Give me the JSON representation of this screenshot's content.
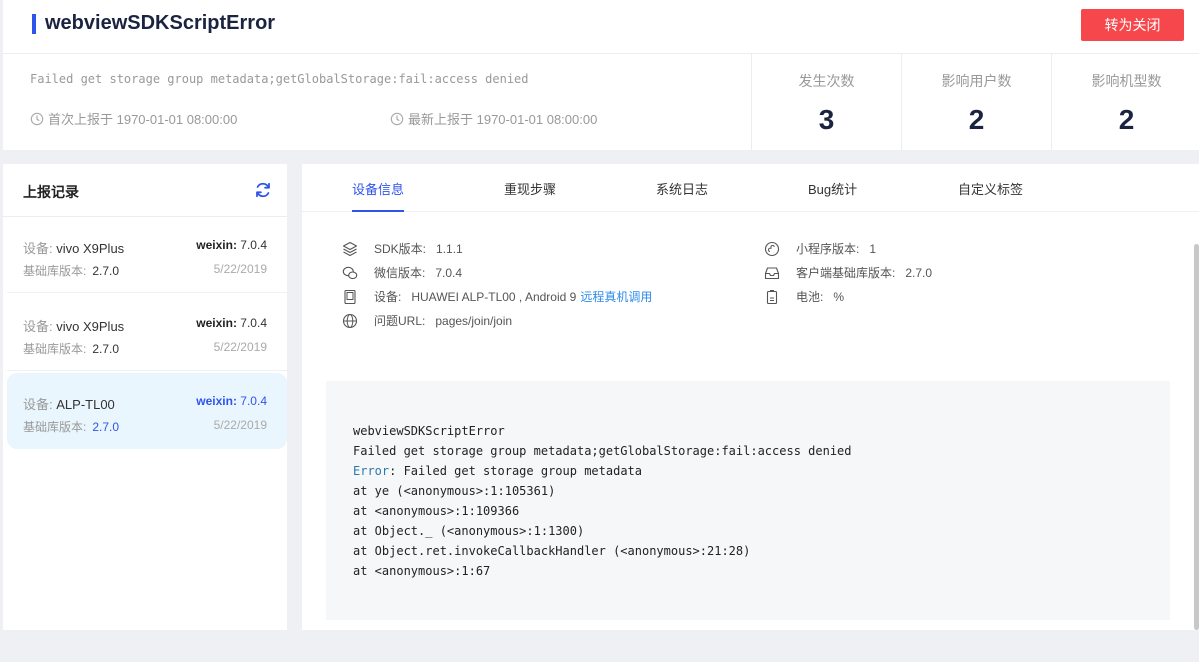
{
  "header": {
    "title": "webviewSDKScriptError",
    "close_button": "转为关闭",
    "error_message": "Failed get storage group metadata;getGlobalStorage:fail:access denied",
    "first_report": "首次上报于 1970-01-01 08:00:00",
    "last_report": "最新上报于 1970-01-01 08:00:00",
    "stats": [
      {
        "label": "发生次数",
        "value": "3"
      },
      {
        "label": "影响用户数",
        "value": "2"
      },
      {
        "label": "影响机型数",
        "value": "2"
      }
    ]
  },
  "records": {
    "title": "上报记录",
    "device_prefix": "设备:",
    "base_prefix": "基础库版本:",
    "items": [
      {
        "device": "vivo X9Plus",
        "app": "weixin:",
        "app_version": "7.0.4",
        "base": "2.7.0",
        "date": "5/22/2019"
      },
      {
        "device": "vivo X9Plus",
        "app": "weixin:",
        "app_version": "7.0.4",
        "base": "2.7.0",
        "date": "5/22/2019"
      },
      {
        "device": "ALP-TL00",
        "app": "weixin:",
        "app_version": "7.0.4",
        "base": "2.7.0",
        "date": "5/22/2019"
      }
    ]
  },
  "tabs": [
    "设备信息",
    "重现步骤",
    "系统日志",
    "Bug统计",
    "自定义标签"
  ],
  "device_info": {
    "sdk_label": "SDK版本:",
    "sdk_value": "1.1.1",
    "wechat_label": "微信版本:",
    "wechat_value": "7.0.4",
    "device_label": "设备:",
    "device_value": "HUAWEI ALP-TL00 , Android 9",
    "device_link": "远程真机调用",
    "url_label": "问题URL:",
    "url_value": "pages/join/join",
    "mp_label": "小程序版本:",
    "mp_value": "1",
    "client_label": "客户端基础库版本:",
    "client_value": "2.7.0",
    "battery_label": "电池:",
    "battery_value": "%"
  },
  "stack": {
    "line1": "webviewSDKScriptError",
    "line2": "Failed get storage group metadata;getGlobalStorage:fail:access denied",
    "line3_kw": "Error",
    "line3_rest": ": Failed get storage group metadata",
    "line4": "at ye (<anonymous>:1:105361)",
    "line5": "at <anonymous>:1:109366",
    "line6": "at Object._ (<anonymous>:1:1300)",
    "line7": "at Object.ret.invokeCallbackHandler (<anonymous>:21:28)",
    "line8": "at <anonymous>:1:67"
  },
  "colors": {
    "accent": "#2f54eb",
    "danger": "#f5474c",
    "link": "#2f8ceb"
  }
}
